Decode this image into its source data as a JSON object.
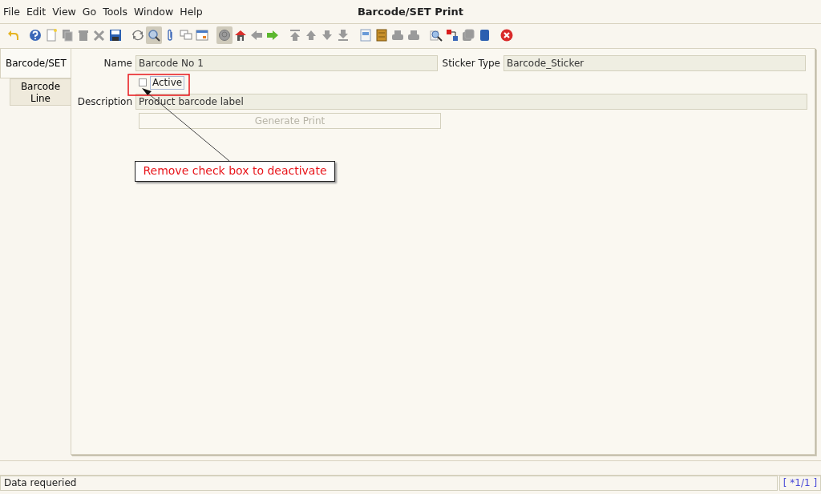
{
  "window": {
    "title": "Barcode/SET Print"
  },
  "menu": [
    "File",
    "Edit",
    "View",
    "Go",
    "Tools",
    "Window",
    "Help"
  ],
  "toolbar": [
    {
      "disabled": false,
      "pressed": false
    },
    {
      "disabled": false,
      "pressed": false
    },
    {
      "disabled": false,
      "pressed": false
    },
    {
      "disabled": true,
      "pressed": false
    },
    {
      "disabled": true,
      "pressed": false
    },
    {
      "disabled": true,
      "pressed": false
    },
    {
      "disabled": false,
      "pressed": false
    },
    {
      "disabled": false,
      "pressed": false
    },
    {
      "disabled": false,
      "pressed": true
    },
    {
      "disabled": false,
      "pressed": false
    },
    {
      "disabled": false,
      "pressed": false
    },
    {
      "disabled": false,
      "pressed": false
    },
    {
      "disabled": true,
      "pressed": true
    },
    {
      "disabled": false,
      "pressed": false
    },
    {
      "disabled": true,
      "pressed": false
    },
    {
      "disabled": false,
      "pressed": false
    },
    {
      "disabled": true,
      "pressed": false
    },
    {
      "disabled": true,
      "pressed": false
    },
    {
      "disabled": true,
      "pressed": false
    },
    {
      "disabled": true,
      "pressed": false
    },
    {
      "disabled": false,
      "pressed": false
    },
    {
      "disabled": false,
      "pressed": false
    },
    {
      "disabled": true,
      "pressed": false
    },
    {
      "disabled": true,
      "pressed": false
    },
    {
      "disabled": false,
      "pressed": false
    },
    {
      "disabled": false,
      "pressed": false
    },
    {
      "disabled": true,
      "pressed": false
    },
    {
      "disabled": false,
      "pressed": false
    },
    {
      "disabled": false,
      "pressed": false
    }
  ],
  "tabs": [
    {
      "label": "Barcode/SET",
      "selected": true
    },
    {
      "label": "Barcode Line",
      "selected": false
    }
  ],
  "form": {
    "name": {
      "label": "Name",
      "value": "Barcode No 1"
    },
    "sticker_type": {
      "label": "Sticker Type",
      "value": "Barcode_Sticker"
    },
    "active": {
      "label": "Active",
      "checked": false
    },
    "description": {
      "label": "Description",
      "value": "Product barcode label"
    },
    "generate_button": {
      "label": "Generate Print",
      "disabled": true
    }
  },
  "annotation": {
    "text": "Remove check box to deactivate"
  },
  "status_bar": {
    "message": "Data requeried",
    "record": "[ *1/1 ]"
  }
}
